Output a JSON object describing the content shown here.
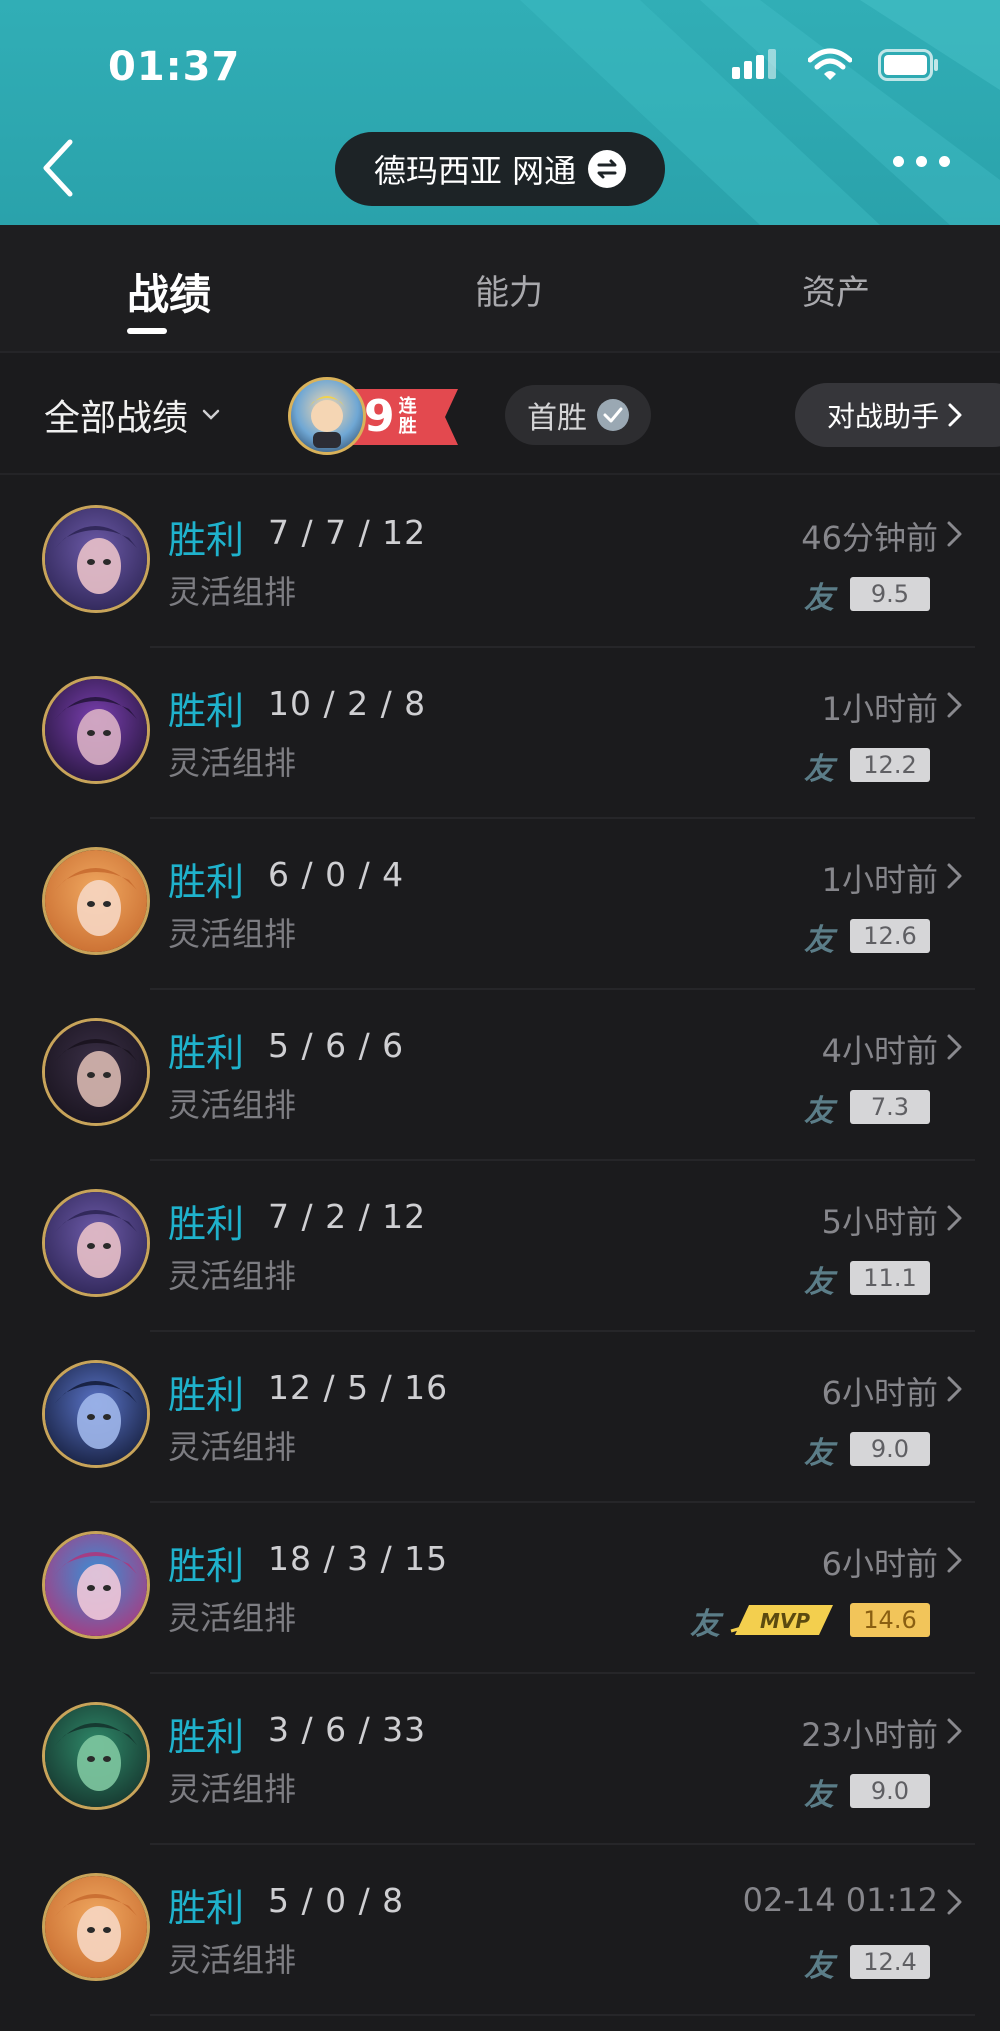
{
  "status_bar": {
    "time": "01:37"
  },
  "header": {
    "server": "德玛西亚 网通"
  },
  "tabs": [
    {
      "label": "战绩",
      "active": true
    },
    {
      "label": "能力",
      "active": false
    },
    {
      "label": "资产",
      "active": false
    }
  ],
  "filter": {
    "label": "全部战绩",
    "streak_count": "9",
    "streak_text": "连胜",
    "first_win": "首胜",
    "assistant": "对战助手"
  },
  "colors": {
    "win": "#1fb2cc",
    "header_bg": "#31aeb6",
    "mvp_score_bg": "#f2c55a"
  },
  "matches": [
    {
      "result": "胜利",
      "kda": "7 / 7 / 12",
      "mode": "灵活组排",
      "time": "46分钟前",
      "friend": "友",
      "score": "9.5",
      "mvp": false,
      "champion": "purple-haired-mage"
    },
    {
      "result": "胜利",
      "kda": "10 / 2 / 8",
      "mode": "灵活组排",
      "time": "1小时前",
      "friend": "友",
      "score": "12.2",
      "mvp": false,
      "champion": "dark-queen"
    },
    {
      "result": "胜利",
      "kda": "6 / 0 / 4",
      "mode": "灵活组排",
      "time": "1小时前",
      "friend": "友",
      "score": "12.6",
      "mvp": false,
      "champion": "blonde-heroine"
    },
    {
      "result": "胜利",
      "kda": "5 / 6 / 6",
      "mode": "灵活组排",
      "time": "4小时前",
      "friend": "友",
      "score": "7.3",
      "mvp": false,
      "champion": "hat-sharpshooter"
    },
    {
      "result": "胜利",
      "kda": "7 / 2 / 12",
      "mode": "灵活组排",
      "time": "5小时前",
      "friend": "友",
      "score": "11.1",
      "mvp": false,
      "champion": "purple-haired-mage"
    },
    {
      "result": "胜利",
      "kda": "12 / 5 / 16",
      "mode": "灵活组排",
      "time": "6小时前",
      "friend": "友",
      "score": "9.0",
      "mvp": false,
      "champion": "dark-helm"
    },
    {
      "result": "胜利",
      "kda": "18 / 3 / 15",
      "mode": "灵活组排",
      "time": "6小时前",
      "friend": "友",
      "score": "14.6",
      "mvp": true,
      "mvp_label": "MVP",
      "champion": "blue-haired-gunner"
    },
    {
      "result": "胜利",
      "kda": "3 / 6 / 33",
      "mode": "灵活组排",
      "time": "23小时前",
      "friend": "友",
      "score": "9.0",
      "mvp": false,
      "champion": "green-serpent"
    },
    {
      "result": "胜利",
      "kda": "5 / 0 / 8",
      "mode": "灵活组排",
      "time": "02-14 01:12",
      "friend": "友",
      "score": "12.4",
      "mvp": false,
      "champion": "blonde-heroine"
    }
  ]
}
